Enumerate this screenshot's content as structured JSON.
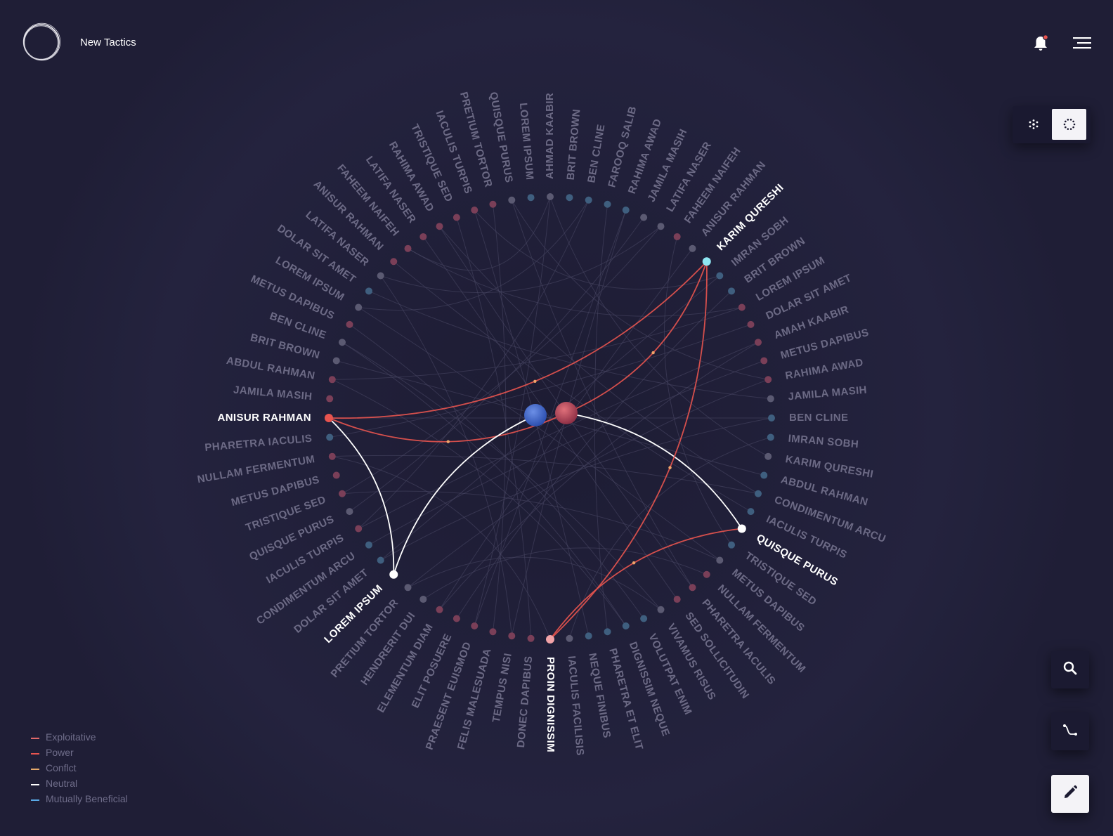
{
  "app": {
    "title": "New Tactics"
  },
  "header": {
    "logo_icon": "circle-logo-icon",
    "notifications_icon": "bell-icon",
    "notification_indicator_color": "#e8544f",
    "menu_icon": "hamburger-menu-icon"
  },
  "view_toggle": {
    "options": [
      {
        "icon": "cluster-view-icon",
        "selected": false
      },
      {
        "icon": "radial-view-icon",
        "selected": true
      }
    ]
  },
  "tools": [
    {
      "icon": "search-icon"
    },
    {
      "icon": "path-icon"
    },
    {
      "icon": "edit-pencil-icon"
    }
  ],
  "colors": {
    "background": "#1f1e36",
    "inactive_label": "#6c6a85",
    "active_label": "#ffffff",
    "exploitative": "#e0696a",
    "power": "#e8544f",
    "conflict": "#e6a96a",
    "neutral": "#ffffff",
    "mutually_beneficial": "#5aa9e6",
    "node_red": "#7a3f58",
    "node_blue": "#3f5f7f",
    "node_gray": "#5b5a72"
  },
  "legend": [
    {
      "label": "Exploitative",
      "color": "#e0696a"
    },
    {
      "label": "Power",
      "color": "#e8544f"
    },
    {
      "label": "Conflct",
      "color": "#e6a96a"
    },
    {
      "label": "Neutral",
      "color": "#ffffff"
    },
    {
      "label": "Mutually Beneficial",
      "color": "#5aa9e6"
    }
  ],
  "graph": {
    "layout": "radial",
    "nodes": [
      {
        "label": "AHMAD KAABIR",
        "type": "gray"
      },
      {
        "label": "BRIT BROWN",
        "type": "blue"
      },
      {
        "label": "BEN CLINE",
        "type": "blue"
      },
      {
        "label": "FAROOQ SALIB",
        "type": "blue"
      },
      {
        "label": "RAHIMA AWAD",
        "type": "blue"
      },
      {
        "label": "JAMILA MASIH",
        "type": "gray"
      },
      {
        "label": "LATIFA NASER",
        "type": "gray"
      },
      {
        "label": "FAHEEM NAIFEH",
        "type": "red"
      },
      {
        "label": "ANISUR RAHMAN",
        "type": "gray"
      },
      {
        "label": "KARIM QURESHI",
        "type": "active-cyan",
        "highlighted": true
      },
      {
        "label": "IMRAN SOBH",
        "type": "blue"
      },
      {
        "label": "BRIT BROWN",
        "type": "blue"
      },
      {
        "label": "LOREM IPSUM",
        "type": "red"
      },
      {
        "label": "DOLAR SIT AMET",
        "type": "red"
      },
      {
        "label": "AMAH KAABIR",
        "type": "red"
      },
      {
        "label": "METUS DAPIBUS",
        "type": "red"
      },
      {
        "label": "RAHIMA AWAD",
        "type": "red"
      },
      {
        "label": "JAMILA MASIH",
        "type": "gray"
      },
      {
        "label": "BEN CLINE",
        "type": "blue"
      },
      {
        "label": "IMRAN SOBH",
        "type": "blue"
      },
      {
        "label": "KARIM QURESHI",
        "type": "gray"
      },
      {
        "label": "ABDUL RAHMAN",
        "type": "blue"
      },
      {
        "label": "CONDIMENTUM ARCU",
        "type": "blue"
      },
      {
        "label": "IACULIS TURPIS",
        "type": "blue"
      },
      {
        "label": "QUISQUE PURUS",
        "type": "active-white",
        "highlighted": true
      },
      {
        "label": "TRISTIQUE SED",
        "type": "blue"
      },
      {
        "label": "METUS DAPIBUS",
        "type": "gray"
      },
      {
        "label": "NULLAM FERMENTUM",
        "type": "red"
      },
      {
        "label": "PHARETRA IACULIS",
        "type": "red"
      },
      {
        "label": "SED SOLLICITUDIN",
        "type": "red"
      },
      {
        "label": "VIVAMUS RISUS",
        "type": "gray"
      },
      {
        "label": "VOLUTPAT ENIM",
        "type": "blue"
      },
      {
        "label": "DIGNISSIM NEQUE",
        "type": "blue"
      },
      {
        "label": "PHARETRA ET ELIT",
        "type": "blue"
      },
      {
        "label": "NEQUE FINIBUS",
        "type": "blue"
      },
      {
        "label": "IACULIS FACILISIS",
        "type": "gray"
      },
      {
        "label": "PROIN DIGNISSIM",
        "type": "active-pink",
        "highlighted": true
      },
      {
        "label": "DONEC DAPIBUS",
        "type": "red"
      },
      {
        "label": "TEMPUS NISI",
        "type": "red"
      },
      {
        "label": "FELIS MALESUADA",
        "type": "red"
      },
      {
        "label": "PRAESENT EUISMOD",
        "type": "red"
      },
      {
        "label": "ELIT POSUERE",
        "type": "red"
      },
      {
        "label": "ELEMENTUM DIAM",
        "type": "red"
      },
      {
        "label": "HENDRERIT DUI",
        "type": "gray"
      },
      {
        "label": "PRETIUM TORTOR",
        "type": "gray"
      },
      {
        "label": "LOREM IPSUM",
        "type": "active-white",
        "highlighted": true
      },
      {
        "label": "DOLAR SIT AMET",
        "type": "blue"
      },
      {
        "label": "CONDIMENTUM ARCU",
        "type": "blue"
      },
      {
        "label": "IACULIS TURPIS",
        "type": "red"
      },
      {
        "label": "QUISQUE PURUS",
        "type": "gray"
      },
      {
        "label": "TRISTIQUE SED",
        "type": "red"
      },
      {
        "label": "METUS DAPIBUS",
        "type": "red"
      },
      {
        "label": "NULLAM FERMENTUM",
        "type": "red"
      },
      {
        "label": "PHARETRA IACULIS",
        "type": "blue"
      },
      {
        "label": "ANISUR RAHMAN",
        "type": "active-red",
        "highlighted": true
      },
      {
        "label": "JAMILA MASIH",
        "type": "red"
      },
      {
        "label": "ABDUL RAHMAN",
        "type": "red"
      },
      {
        "label": "BRIT BROWN",
        "type": "gray"
      },
      {
        "label": "BEN CLINE",
        "type": "gray"
      },
      {
        "label": "METUS DAPIBUS",
        "type": "red"
      },
      {
        "label": "LOREM IPSUM",
        "type": "gray"
      },
      {
        "label": "DOLAR SIT AMET",
        "type": "blue"
      },
      {
        "label": "LATIFA NASER",
        "type": "gray"
      },
      {
        "label": "ANISUR RAHMAN",
        "type": "red"
      },
      {
        "label": "FAHEEM NAIFEH",
        "type": "red"
      },
      {
        "label": "LATIFA NASER",
        "type": "red"
      },
      {
        "label": "RAHIMA AWAD",
        "type": "red"
      },
      {
        "label": "TRISTIQUE SED",
        "type": "red"
      },
      {
        "label": "IACULIS TURPIS",
        "type": "red"
      },
      {
        "label": "PRETIUM TORTOR",
        "type": "red"
      },
      {
        "label": "QUISQUE PURUS",
        "type": "gray"
      },
      {
        "label": "LOREM IPSUM",
        "type": "blue"
      }
    ],
    "highlighted_edges": [
      {
        "from": 54,
        "to": "center-red",
        "type": "power"
      },
      {
        "from": 9,
        "to": "center-red",
        "type": "power"
      },
      {
        "from": 54,
        "to": 9,
        "type": "power"
      },
      {
        "from": 54,
        "to": 45,
        "type": "neutral"
      },
      {
        "from": "center-blue",
        "to": 45,
        "type": "neutral"
      },
      {
        "from": "center-red",
        "to": 24,
        "type": "neutral"
      },
      {
        "from": 36,
        "to": 9,
        "type": "power"
      },
      {
        "from": 36,
        "to": 24,
        "type": "power"
      }
    ],
    "background_edges": [
      [
        0,
        40
      ],
      [
        0,
        20
      ],
      [
        2,
        60
      ],
      [
        4,
        38
      ],
      [
        6,
        62
      ],
      [
        8,
        42
      ],
      [
        10,
        46
      ],
      [
        12,
        64
      ],
      [
        14,
        48
      ],
      [
        16,
        44
      ],
      [
        18,
        54
      ],
      [
        22,
        66
      ],
      [
        26,
        50
      ],
      [
        28,
        70
      ],
      [
        30,
        58
      ],
      [
        32,
        56
      ],
      [
        34,
        68
      ],
      [
        36,
        52
      ],
      [
        38,
        62
      ],
      [
        40,
        4
      ],
      [
        42,
        14
      ],
      [
        44,
        30
      ],
      [
        46,
        18
      ],
      [
        48,
        2
      ],
      [
        50,
        6
      ],
      [
        52,
        22
      ],
      [
        56,
        12
      ],
      [
        58,
        32
      ],
      [
        60,
        26
      ],
      [
        64,
        0
      ],
      [
        66,
        28
      ],
      [
        68,
        10
      ],
      [
        70,
        16
      ],
      [
        3,
        33
      ],
      [
        5,
        49
      ],
      [
        7,
        25
      ],
      [
        11,
        41
      ],
      [
        13,
        53
      ],
      [
        15,
        47
      ],
      [
        17,
        61
      ],
      [
        19,
        35
      ],
      [
        21,
        57
      ],
      [
        23,
        63
      ],
      [
        27,
        43
      ],
      [
        29,
        65
      ],
      [
        31,
        59
      ],
      [
        37,
        67
      ],
      [
        39,
        69
      ]
    ]
  }
}
